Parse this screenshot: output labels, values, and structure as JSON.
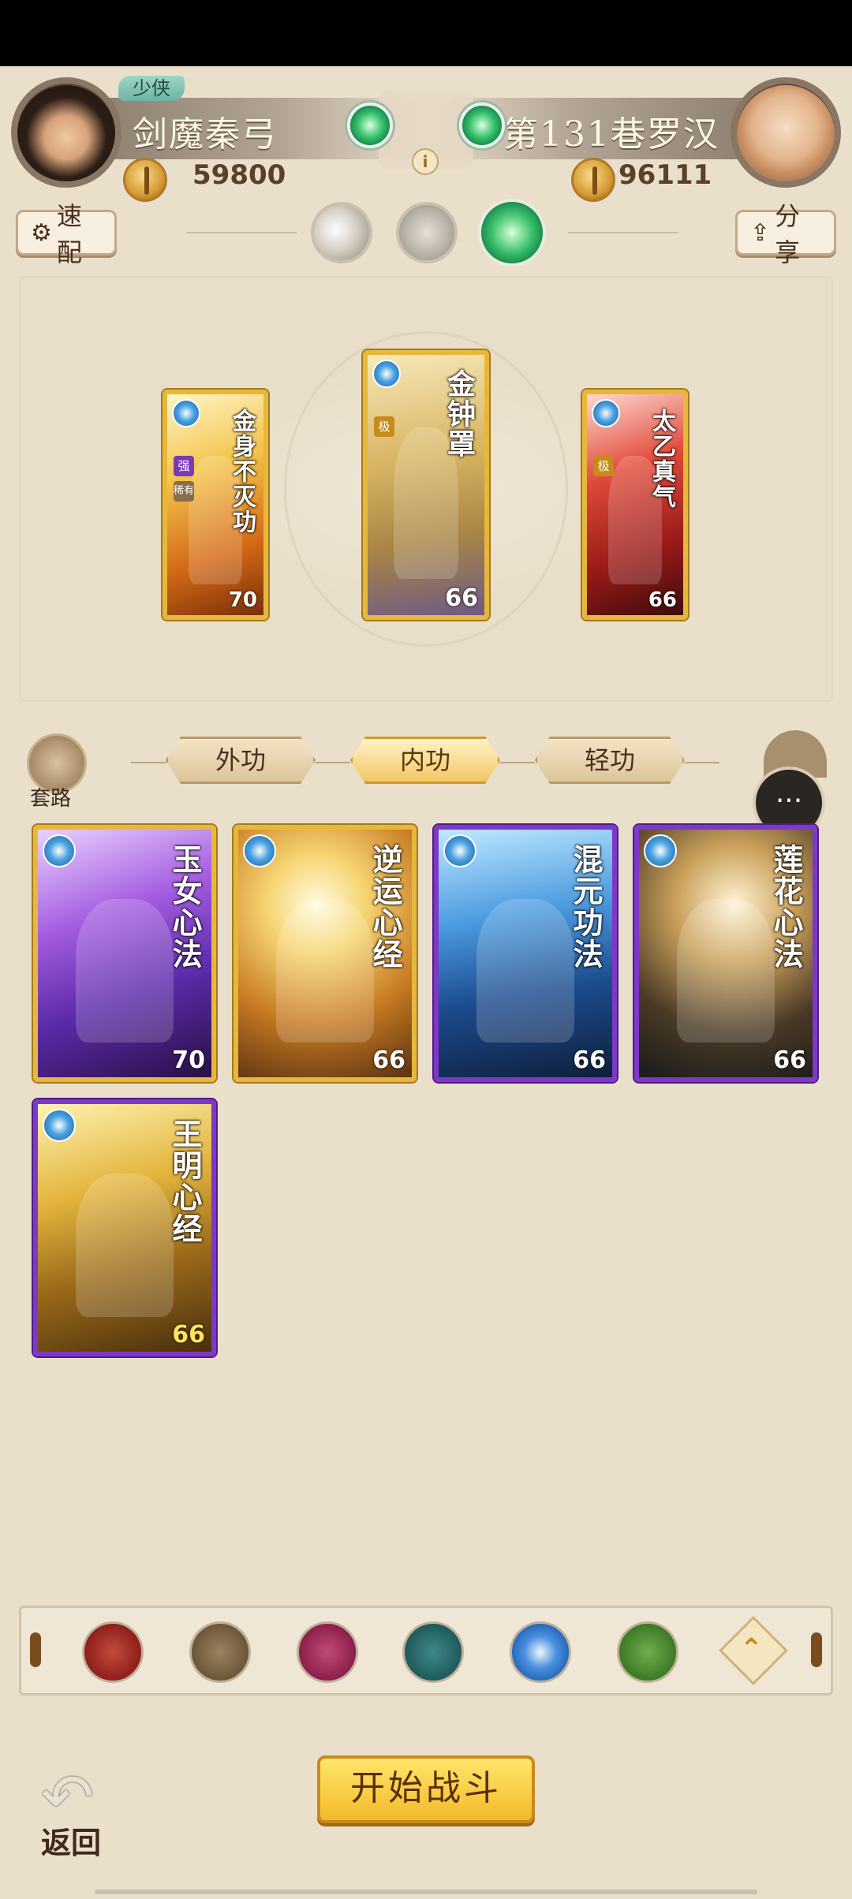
{
  "player_left": {
    "rank": "少侠",
    "name": "剑魔秦弓",
    "power": "59800"
  },
  "player_right": {
    "name": "第131巷罗汉",
    "power": "96111"
  },
  "toolbar": {
    "quick_label": "速配",
    "share_label": "分享"
  },
  "equipped_cards": [
    {
      "title": "金身不灭功",
      "level": "70",
      "badges": [
        "强",
        "稀有"
      ],
      "color": "#e7b73b"
    },
    {
      "title": "金钟罩",
      "level": "66",
      "badges": [
        "极"
      ],
      "color": "#e7b73b"
    },
    {
      "title": "太乙真气",
      "level": "66",
      "badges": [
        "极"
      ],
      "color": "#e7b73b"
    }
  ],
  "routine_label": "套路",
  "category_tabs": [
    {
      "label": "外功",
      "active": false
    },
    {
      "label": "内功",
      "active": true
    },
    {
      "label": "轻功",
      "active": false
    }
  ],
  "collection_cards": [
    {
      "title": "玉女心法",
      "level": "70",
      "frame": "gold"
    },
    {
      "title": "逆运心经",
      "level": "66",
      "frame": "gold"
    },
    {
      "title": "混元功法",
      "level": "66",
      "frame": "purple"
    },
    {
      "title": "莲花心法",
      "level": "66",
      "frame": "purple"
    },
    {
      "title": "王明心经",
      "level": "66",
      "frame": "purple"
    }
  ],
  "filters": [
    {
      "icon": "sword-element-icon",
      "color": "#8e1f1a"
    },
    {
      "icon": "blade-element-icon",
      "color": "#6b5738"
    },
    {
      "icon": "fist-element-icon",
      "color": "#8c1f4a"
    },
    {
      "icon": "fan-element-icon",
      "color": "#1f5a5a"
    },
    {
      "icon": "taiji-element-icon",
      "color": "#1d5fb0"
    },
    {
      "icon": "dragon-element-icon",
      "color": "#3d7a24"
    }
  ],
  "back_label": "返回",
  "start_label": "开始战斗"
}
